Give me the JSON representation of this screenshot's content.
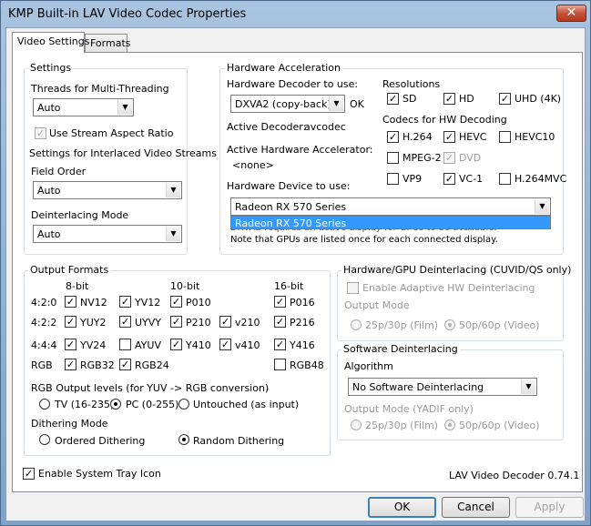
{
  "window": {
    "title": "KMP Built-in LAV Video Codec Properties",
    "close_glyph": "✕"
  },
  "tabs": [
    {
      "label": "Video Settings",
      "active": true
    },
    {
      "label": "Formats",
      "active": false
    }
  ],
  "settings": {
    "title": "Settings",
    "threads_label": "Threads for Multi-Threading",
    "threads_value": "Auto",
    "stream_aspect_label": "Use Stream Aspect Ratio",
    "interlaced_label": "Settings for Interlaced Video Streams",
    "field_order_label": "Field Order",
    "field_order_value": "Auto",
    "deint_mode_label": "Deinterlacing Mode",
    "deint_mode_value": "Auto"
  },
  "hwaccel": {
    "title": "Hardware Acceleration",
    "decoder_label": "Hardware Decoder to use:",
    "decoder_value": "DXVA2 (copy-back)",
    "decoder_status": "OK",
    "active_decoder_label": "Active Decoder:",
    "active_decoder_value": "avcodec",
    "active_accel_label": "Active Hardware Accelerator:",
    "active_accel_value": "<none>",
    "device_label": "Hardware Device to use:",
    "device_value": "Radeon RX 570 Series",
    "device_dropdown_item": "Radeon RX 570 Series",
    "note_line1": "DXVA2 requires an active display for GPUs to be available.",
    "note_line2": "Note that GPUs are listed once for each connected display.",
    "resolutions_label": "Resolutions",
    "res_sd": "SD",
    "res_hd": "HD",
    "res_uhd": "UHD (4K)",
    "codecs_label": "Codecs for HW Decoding",
    "codec_h264": "H.264",
    "codec_hevc": "HEVC",
    "codec_hevc10": "HEVC10",
    "codec_mpeg2": "MPEG-2",
    "codec_dvd": "DVD",
    "codec_vp9": "VP9",
    "codec_vc1": "VC-1",
    "codec_h264mvc": "H.264MVC"
  },
  "output": {
    "title": "Output Formats",
    "col_8bit": "8-bit",
    "col_10bit": "10-bit",
    "col_16bit": "16-bit",
    "row_420": "4:2:0",
    "row_422": "4:2:2",
    "row_444": "4:4:4",
    "row_rgb": "RGB",
    "nv12": "NV12",
    "yv12": "YV12",
    "p010": "P010",
    "p016": "P016",
    "yuy2": "YUY2",
    "uyvy": "UYVY",
    "p210": "P210",
    "v210": "v210",
    "p216": "P216",
    "yv24": "YV24",
    "ayuv": "AYUV",
    "y410": "Y410",
    "v410": "v410",
    "y416": "Y416",
    "rgb32": "RGB32",
    "rgb24": "RGB24",
    "rgb48": "RGB48",
    "levels_label": "RGB Output levels (for YUV -> RGB conversion)",
    "level_tv": "TV (16-235)",
    "level_pc": "PC (0-255)",
    "level_untouched": "Untouched (as input)",
    "dither_label": "Dithering Mode",
    "dither_ordered": "Ordered Dithering",
    "dither_random": "Random Dithering"
  },
  "hwdeint": {
    "title": "Hardware/GPU Deinterlacing (CUVID/QS only)",
    "enable_label": "Enable Adaptive HW Deinterlacing",
    "output_mode_label": "Output Mode",
    "opt_film": "25p/30p (Film)",
    "opt_video": "50p/60p (Video)"
  },
  "swdeint": {
    "title": "Software Deinterlacing",
    "algorithm_label": "Algorithm",
    "algorithm_value": "No Software Deinterlacing",
    "output_mode_label": "Output Mode (YADIF only)",
    "opt_film": "25p/30p (Film)",
    "opt_video": "50p/60p (Video)"
  },
  "footer": {
    "tray_label": "Enable System Tray Icon",
    "version": "LAV Video Decoder 0.74.1"
  },
  "buttons": {
    "ok": "OK",
    "cancel": "Cancel",
    "apply": "Apply"
  },
  "check_glyph": "✓",
  "arrow_glyph": "▼"
}
